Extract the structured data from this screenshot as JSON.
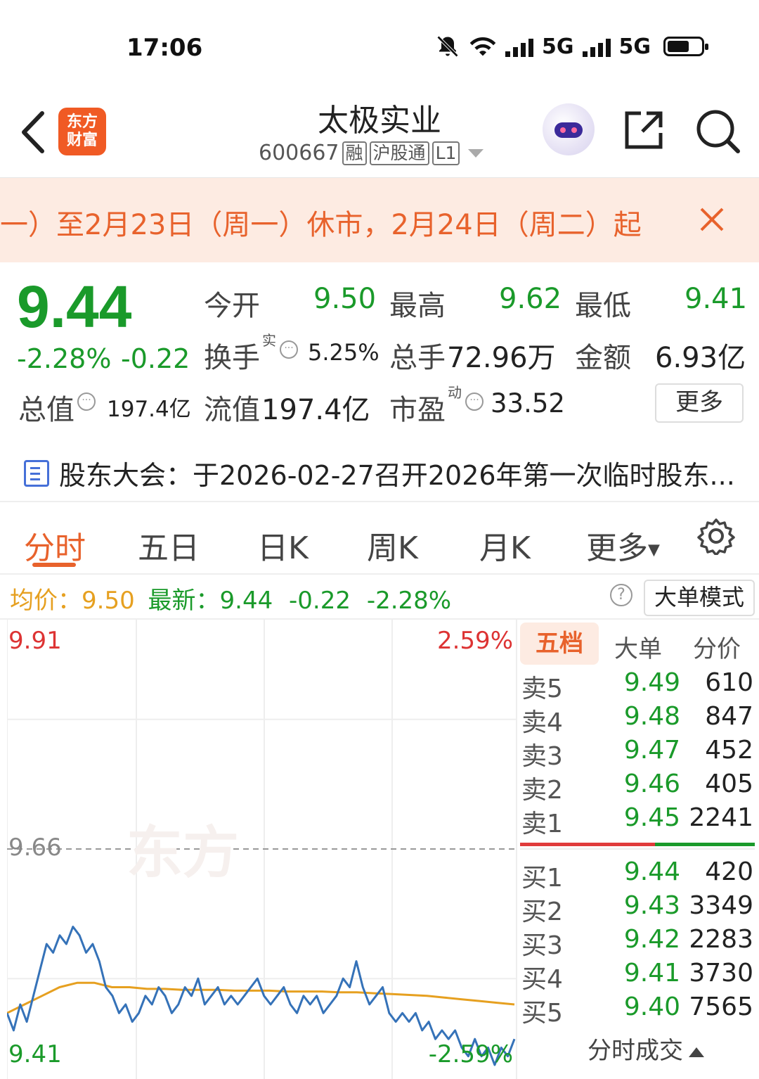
{
  "status_bar": {
    "time": "17:06",
    "net1": "5G",
    "net2": "5G"
  },
  "header": {
    "app_logo_line1": "东方",
    "app_logo_line2": "财富",
    "stock_name": "太极实业",
    "stock_code": "600667",
    "tags": [
      "融",
      "沪股通",
      "L1"
    ]
  },
  "notice": {
    "text": "一）至2月23日（周一）休市，2月24日（周二）起"
  },
  "quote": {
    "price": "9.44",
    "change_pct": "-2.28%",
    "change": "-0.22",
    "open_label": "今开",
    "open": "9.50",
    "high_label": "最高",
    "high": "9.62",
    "low_label": "最低",
    "low": "9.41",
    "turnover_label": "换手",
    "turnover_sup": "实",
    "turnover": "5.25%",
    "volume_label": "总手",
    "volume": "72.96万",
    "amount_label": "金额",
    "amount": "6.93亿",
    "mktcap_label": "总值",
    "mktcap": "197.4亿",
    "float_label": "流值",
    "float_cap": "197.4亿",
    "pe_label": "市盈",
    "pe_sup": "动",
    "pe": "33.52",
    "more_label": "更多"
  },
  "meeting": {
    "text": "股东大会：于2026-02-27召开2026年第一次临时股东..."
  },
  "tabs": [
    "分时",
    "五日",
    "日K",
    "周K",
    "月K",
    "更多"
  ],
  "avg_bar": {
    "avg_label": "均价：",
    "avg": "9.50",
    "latest_label": "最新：",
    "latest": "9.44",
    "change": "-0.22",
    "change_pct": "-2.28%",
    "big_order_mode": "大单模式"
  },
  "chart_data": {
    "type": "line",
    "y_top_label": "9.91",
    "y_mid_label": "9.66",
    "y_bottom_label": "9.41",
    "pct_top_label": "2.59%",
    "pct_bottom_label": "-2.59%",
    "ylim": [
      9.41,
      9.91
    ],
    "prev_close": 9.66,
    "series": [
      {
        "values": [
          9.47,
          9.45,
          9.48,
          9.46,
          9.49,
          9.52,
          9.55,
          9.54,
          9.56,
          9.55,
          9.57,
          9.56,
          9.54,
          9.55,
          9.53,
          9.5,
          9.49,
          9.47,
          9.48,
          9.46,
          9.47,
          9.49,
          9.48,
          9.5,
          9.49,
          9.47,
          9.48,
          9.5,
          9.49,
          9.51,
          9.48,
          9.49,
          9.5,
          9.48,
          9.49,
          9.48,
          9.49,
          9.5,
          9.51,
          9.49,
          9.48,
          9.49,
          9.5,
          9.48,
          9.47,
          9.49,
          9.48,
          9.49,
          9.47,
          9.48,
          9.49,
          9.51,
          9.5,
          9.53,
          9.5,
          9.48,
          9.49,
          9.5,
          9.47,
          9.46,
          9.47,
          9.46,
          9.47,
          9.45,
          9.46,
          9.44,
          9.45,
          9.44,
          9.45,
          9.43,
          9.42,
          9.44,
          9.42,
          9.43,
          9.41,
          9.43,
          9.42,
          9.44
        ]
      },
      {
        "values": [
          9.47,
          9.48,
          9.49,
          9.5,
          9.505,
          9.505,
          9.5,
          9.5,
          9.498,
          9.498,
          9.497,
          9.497,
          9.497,
          9.496,
          9.496,
          9.496,
          9.495,
          9.495,
          9.495,
          9.494,
          9.494,
          9.493,
          9.492,
          9.491,
          9.49,
          9.488,
          9.486,
          9.484,
          9.482,
          9.48
        ]
      }
    ]
  },
  "order_book": {
    "tabs": [
      "五档",
      "大单",
      "分价"
    ],
    "asks": [
      {
        "label": "卖5",
        "price": "9.49",
        "vol": "610"
      },
      {
        "label": "卖4",
        "price": "9.48",
        "vol": "847"
      },
      {
        "label": "卖3",
        "price": "9.47",
        "vol": "452"
      },
      {
        "label": "卖2",
        "price": "9.46",
        "vol": "405"
      },
      {
        "label": "卖1",
        "price": "9.45",
        "vol": "2241"
      }
    ],
    "bids": [
      {
        "label": "买1",
        "price": "9.44",
        "vol": "420"
      },
      {
        "label": "买2",
        "price": "9.43",
        "vol": "3349"
      },
      {
        "label": "买3",
        "price": "9.42",
        "vol": "2283"
      },
      {
        "label": "买4",
        "price": "9.41",
        "vol": "3730"
      },
      {
        "label": "买5",
        "price": "9.40",
        "vol": "7565"
      }
    ],
    "trades_label": "分时成交"
  }
}
